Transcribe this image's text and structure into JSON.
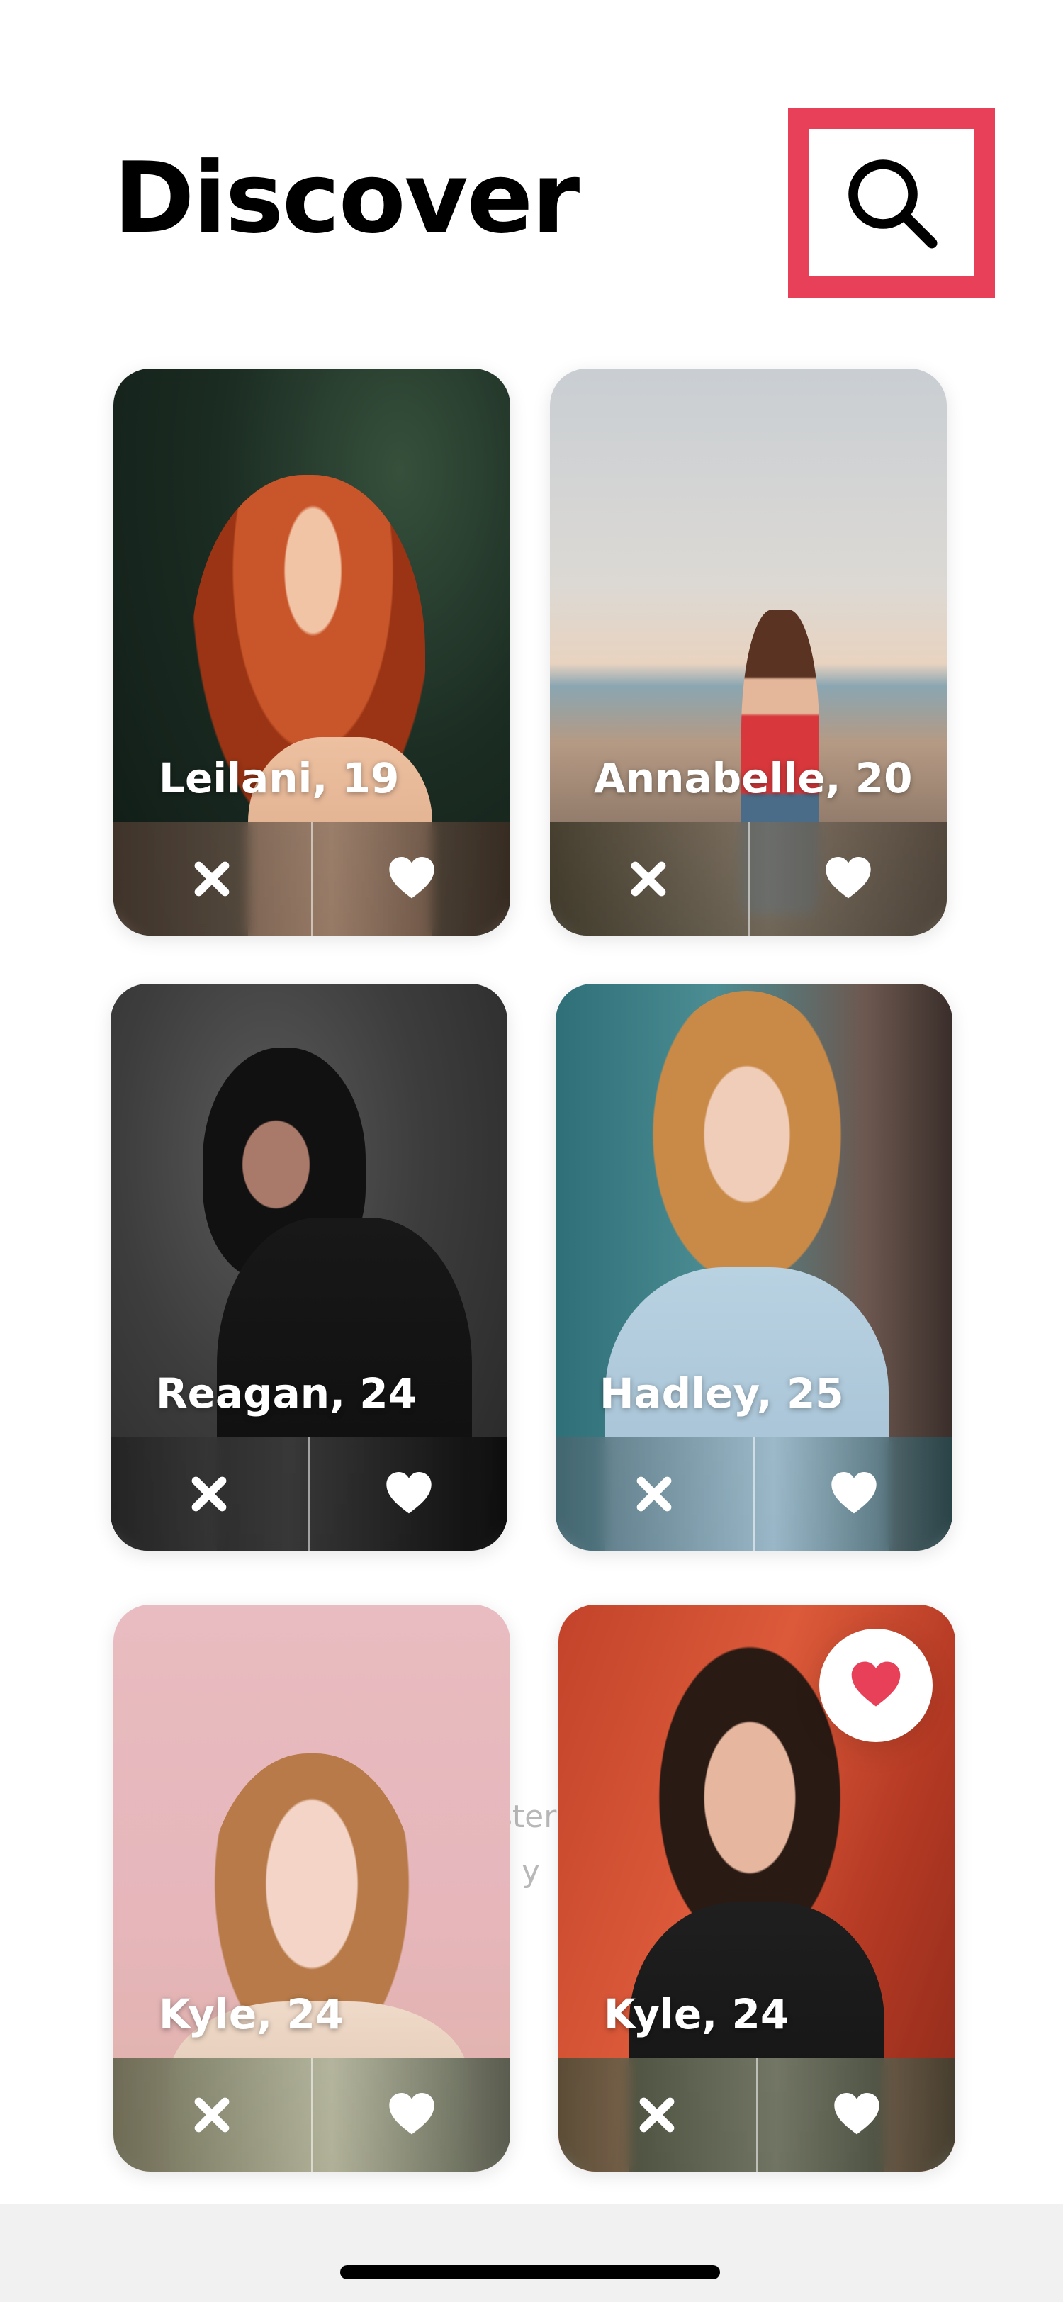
{
  "header": {
    "title": "Discover",
    "search_icon": "search-icon"
  },
  "background_text": {
    "line1": "ster",
    "line2": "y"
  },
  "cards": [
    {
      "name": "Leilani, 19",
      "dislike_icon": "close-icon",
      "like_icon": "heart-icon"
    },
    {
      "name": "Annabelle, 20",
      "dislike_icon": "close-icon",
      "like_icon": "heart-icon"
    },
    {
      "name": "Reagan, 24",
      "dislike_icon": "close-icon",
      "like_icon": "heart-icon"
    },
    {
      "name": "Hadley, 25",
      "dislike_icon": "close-icon",
      "like_icon": "heart-icon"
    },
    {
      "name": "Kyle, 24",
      "dislike_icon": "close-icon",
      "like_icon": "heart-icon"
    },
    {
      "name": "Kyle, 24",
      "dislike_icon": "close-icon",
      "like_icon": "heart-icon"
    }
  ],
  "floating_like": {
    "icon": "heart-icon"
  },
  "colors": {
    "accent": "#e9405a",
    "title": "#000000",
    "background": "#ffffff",
    "home_bar": "#f1f1f1"
  }
}
